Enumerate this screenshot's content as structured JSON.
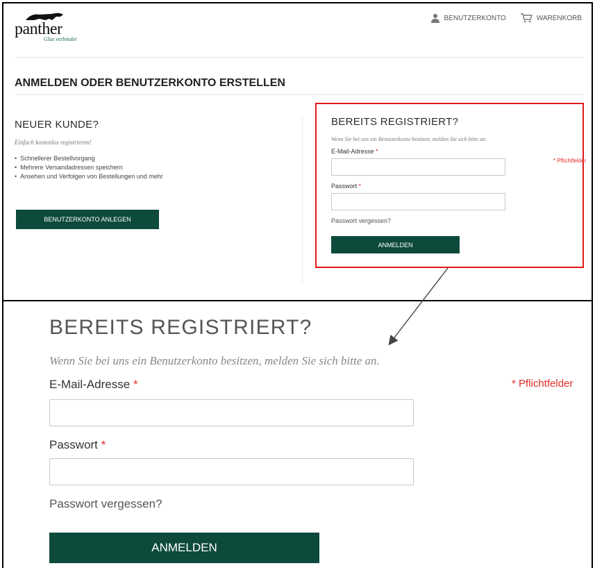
{
  "brand": {
    "logo_text": "panther",
    "tagline": "Glas verbindet"
  },
  "top_nav": {
    "account_label": "BENUTZERKONTO",
    "cart_label": "WARENKORB"
  },
  "page": {
    "title": "ANMELDEN ODER BENUTZERKONTO ERSTELLEN"
  },
  "new_customer": {
    "title": "NEUER KUNDE?",
    "subtitle": "Einfach kostenlos registrieren!",
    "benefits": [
      "Schnellerer Bestellvorgang",
      "Mehrere Versandadressen speichern",
      "Ansehen und Verfolgen von Bestellungen und mehr"
    ],
    "create_button": "BENUTZERKONTO ANLEGEN"
  },
  "login": {
    "title": "BEREITS REGISTRIERT?",
    "subtitle": "Wenn Sie bei uns ein Benutzerkonto besitzen, melden Sie sich bitte an.",
    "email_label": "E-Mail-Adresse",
    "password_label": "Passwort",
    "required_marker": "*",
    "required_note": "* Pflichtfelder",
    "forgot_link": "Passwort vergessen?",
    "submit_button": "ANMELDEN",
    "email_value": "",
    "password_value": ""
  },
  "colors": {
    "brand_green": "#0e4a3c",
    "highlight_red": "#e1191b",
    "required_red": "#e02b27"
  }
}
